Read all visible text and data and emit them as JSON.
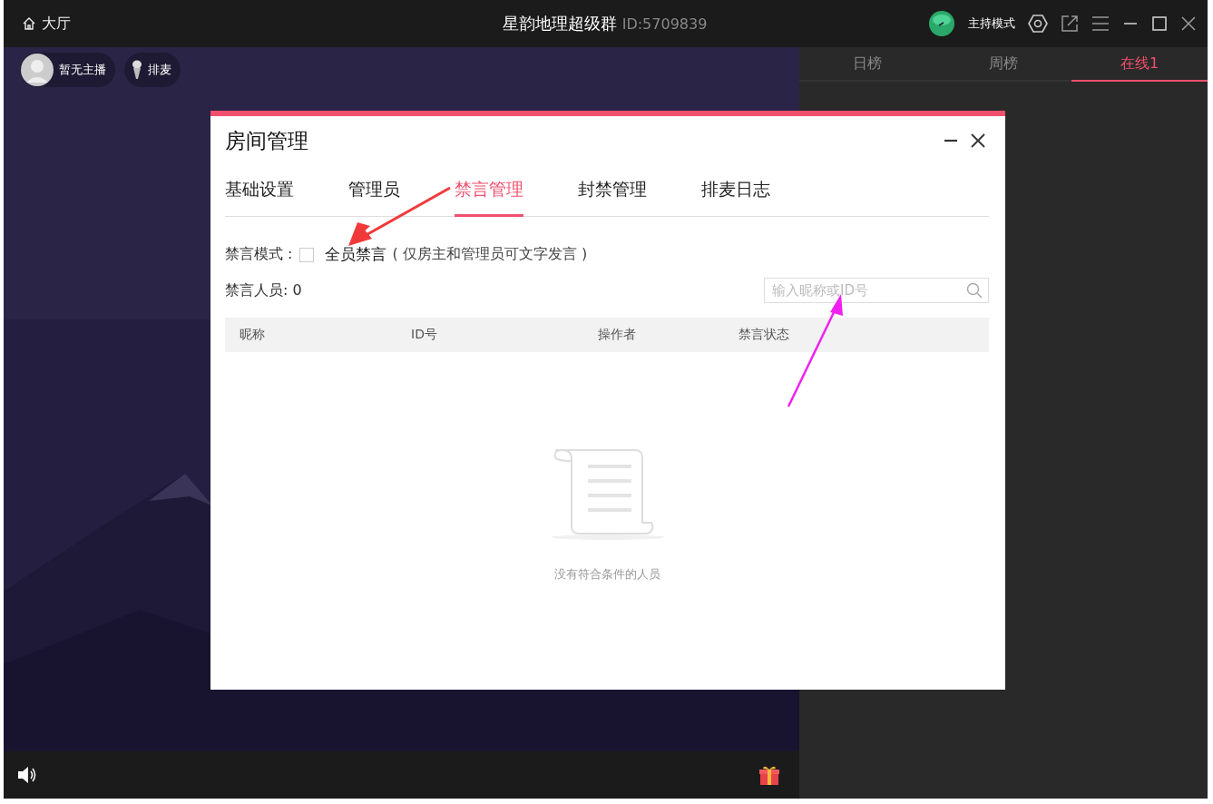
{
  "titlebar": {
    "home": "大厅",
    "title": "星韵地理超级群",
    "room_id": "ID:5709839",
    "mode": "主持模式"
  },
  "host_chips": [
    {
      "kind": "avatar",
      "label": "暂无主播"
    },
    {
      "kind": "mic",
      "label": "排麦"
    }
  ],
  "side_tabs": [
    {
      "label": "日榜",
      "selected": false
    },
    {
      "label": "周榜",
      "selected": false
    },
    {
      "label": "在线1",
      "selected": true
    }
  ],
  "dialog": {
    "title": "房间管理",
    "tabs": [
      {
        "label": "基础设置",
        "selected": false
      },
      {
        "label": "管理员",
        "selected": false
      },
      {
        "label": "禁言管理",
        "selected": true
      },
      {
        "label": "封禁管理",
        "selected": false
      },
      {
        "label": "排麦日志",
        "selected": false
      }
    ],
    "mute_mode": {
      "label": "禁言模式 :",
      "checked": false,
      "option": "全员禁言",
      "note": "( 仅房主和管理员可文字发言 )"
    },
    "muted_count": "禁言人员: 0",
    "search": {
      "placeholder": "输入昵称或ID号"
    },
    "table": {
      "columns": [
        "昵称",
        "ID号",
        "操作者",
        "禁言状态"
      ]
    },
    "empty_text": "没有符合条件的人员"
  }
}
